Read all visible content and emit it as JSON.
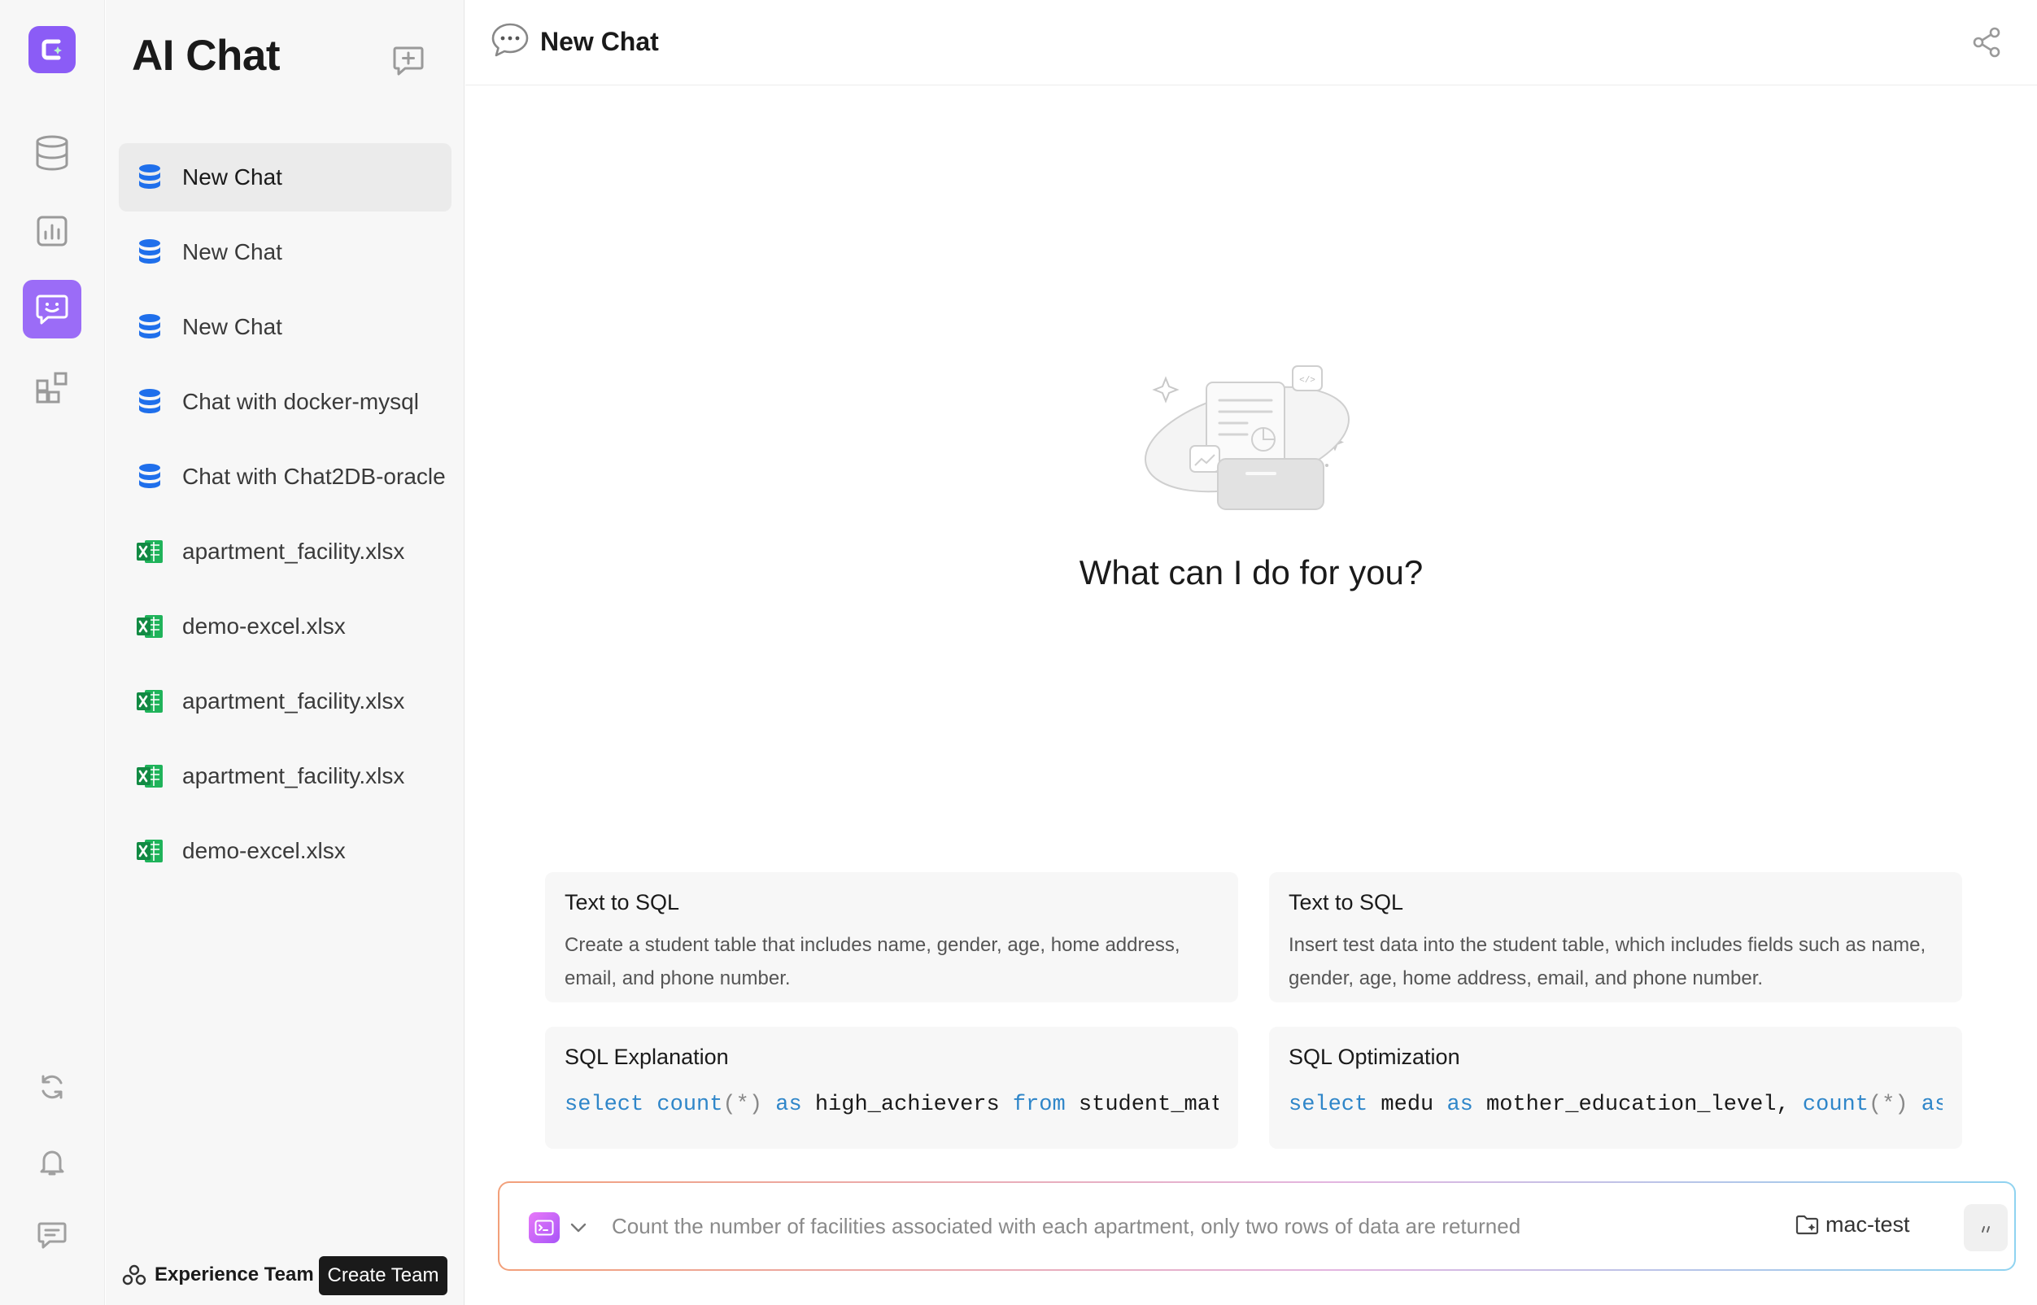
{
  "app": {
    "title": "AI Chat"
  },
  "rail": {
    "items": [
      {
        "icon": "database-icon"
      },
      {
        "icon": "dashboard-icon"
      },
      {
        "icon": "ai-chat-icon",
        "active": true
      },
      {
        "icon": "plugins-icon"
      }
    ],
    "bottom": [
      {
        "icon": "refresh-icon"
      },
      {
        "icon": "bell-icon"
      },
      {
        "icon": "feedback-icon"
      }
    ]
  },
  "sidebar": {
    "title": "AI Chat",
    "chats": [
      {
        "label": "New Chat",
        "type": "database",
        "active": true
      },
      {
        "label": "New Chat",
        "type": "database"
      },
      {
        "label": "New Chat",
        "type": "database"
      },
      {
        "label": "Chat with docker-mysql",
        "type": "database"
      },
      {
        "label": "Chat with Chat2DB-oracle",
        "type": "database"
      },
      {
        "label": "apartment_facility.xlsx",
        "type": "excel"
      },
      {
        "label": "demo-excel.xlsx",
        "type": "excel"
      },
      {
        "label": "apartment_facility.xlsx",
        "type": "excel"
      },
      {
        "label": "apartment_facility.xlsx",
        "type": "excel"
      },
      {
        "label": "demo-excel.xlsx",
        "type": "excel"
      }
    ],
    "footer": {
      "team": "Experience Team ...",
      "create_team": "Create Team"
    }
  },
  "header": {
    "title": "New Chat"
  },
  "main": {
    "prompt": "What can I do for you?",
    "cards": [
      {
        "title": "Text to SQL",
        "desc": "Create a student table that includes name, gender, age, home address, email, and phone number."
      },
      {
        "title": "Text to SQL",
        "desc": "Insert test data into the student table, which includes fields such as name, gender, age, home address, email, and phone number."
      },
      {
        "title": "SQL Explanation",
        "code": "select count(*) as high_achievers from student_mat"
      },
      {
        "title": "SQL Optimization",
        "code": "select medu as mother_education_level, count(*) as"
      }
    ]
  },
  "input": {
    "placeholder": "Count the number of facilities associated with each apartment, only two rows of data are returned",
    "datasource": "mac-test"
  },
  "colors": {
    "accent": "#8b5cf6",
    "db_icon": "#1f6feb",
    "excel_icon": "#1fb35a",
    "sql_keyword": "#2f86c9"
  }
}
